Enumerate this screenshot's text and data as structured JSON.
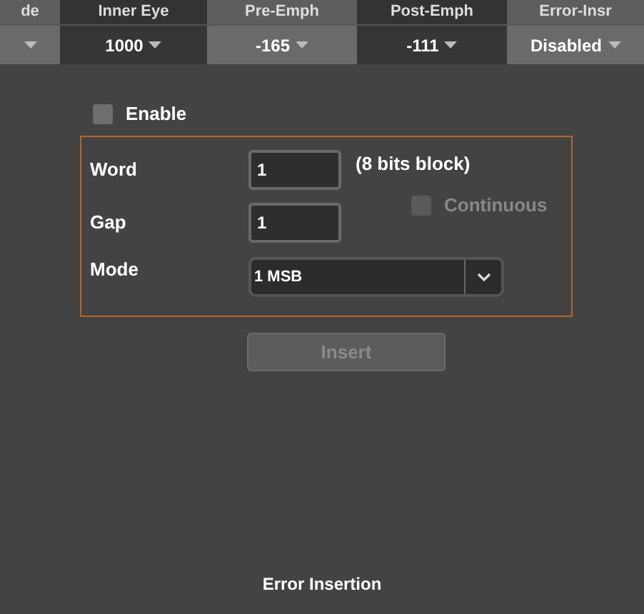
{
  "header": {
    "columns": [
      {
        "label": "de"
      },
      {
        "label": "Inner Eye",
        "value": "1000"
      },
      {
        "label": "Pre-Emph",
        "value": "-165"
      },
      {
        "label": "Post-Emph",
        "value": "-111"
      },
      {
        "label": "Error-Insr",
        "value": "Disabled"
      }
    ]
  },
  "enable": {
    "label": "Enable",
    "checked": false
  },
  "form": {
    "word": {
      "label": "Word",
      "value": "1",
      "note": "(8 bits block)"
    },
    "continuous": {
      "label": "Continuous",
      "checked": false,
      "disabled": true
    },
    "gap": {
      "label": "Gap",
      "value": "1"
    },
    "mode": {
      "label": "Mode",
      "value": "1 MSB"
    }
  },
  "insert_button": {
    "label": "Insert",
    "disabled": true
  },
  "footer": {
    "title": "Error Insertion"
  }
}
